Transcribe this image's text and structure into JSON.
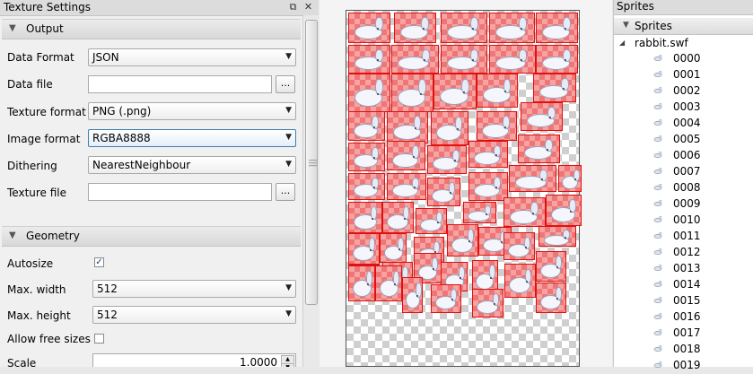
{
  "left_panel": {
    "title": "Texture Settings",
    "float_icon": "float-icon",
    "close_icon": "close-icon",
    "output": {
      "header": "Output",
      "data_format_label": "Data Format",
      "data_format_value": "JSON",
      "data_file_label": "Data file",
      "data_file_value": "",
      "browse_label": "...",
      "texture_format_label": "Texture format",
      "texture_format_value": "PNG (.png)",
      "image_format_label": "Image format",
      "image_format_value": "RGBA8888",
      "dithering_label": "Dithering",
      "dithering_value": "NearestNeighbour",
      "texture_file_label": "Texture file",
      "texture_file_value": ""
    },
    "geometry": {
      "header": "Geometry",
      "autosize_label": "Autosize",
      "autosize_checked": true,
      "max_width_label": "Max. width",
      "max_width_value": "512",
      "max_height_label": "Max. height",
      "max_height_value": "512",
      "allow_free_sizes_label": "Allow free sizes",
      "allow_free_sizes_checked": false,
      "scale_label": "Scale",
      "scale_value": "1.0000"
    }
  },
  "right_panel": {
    "title": "Sprites",
    "tree_header": "Sprites",
    "root_node": "rabbit.swf",
    "items": [
      "0000",
      "0001",
      "0002",
      "0003",
      "0004",
      "0005",
      "0006",
      "0007",
      "0008",
      "0009",
      "0010",
      "0011",
      "0012",
      "0013",
      "0014",
      "0015",
      "0016",
      "0017",
      "0018",
      "0019"
    ]
  },
  "colors": {
    "sprite_fill": "#f5a3a3",
    "sprite_border": "#e01010",
    "focus_border": "#3c7fb1"
  }
}
